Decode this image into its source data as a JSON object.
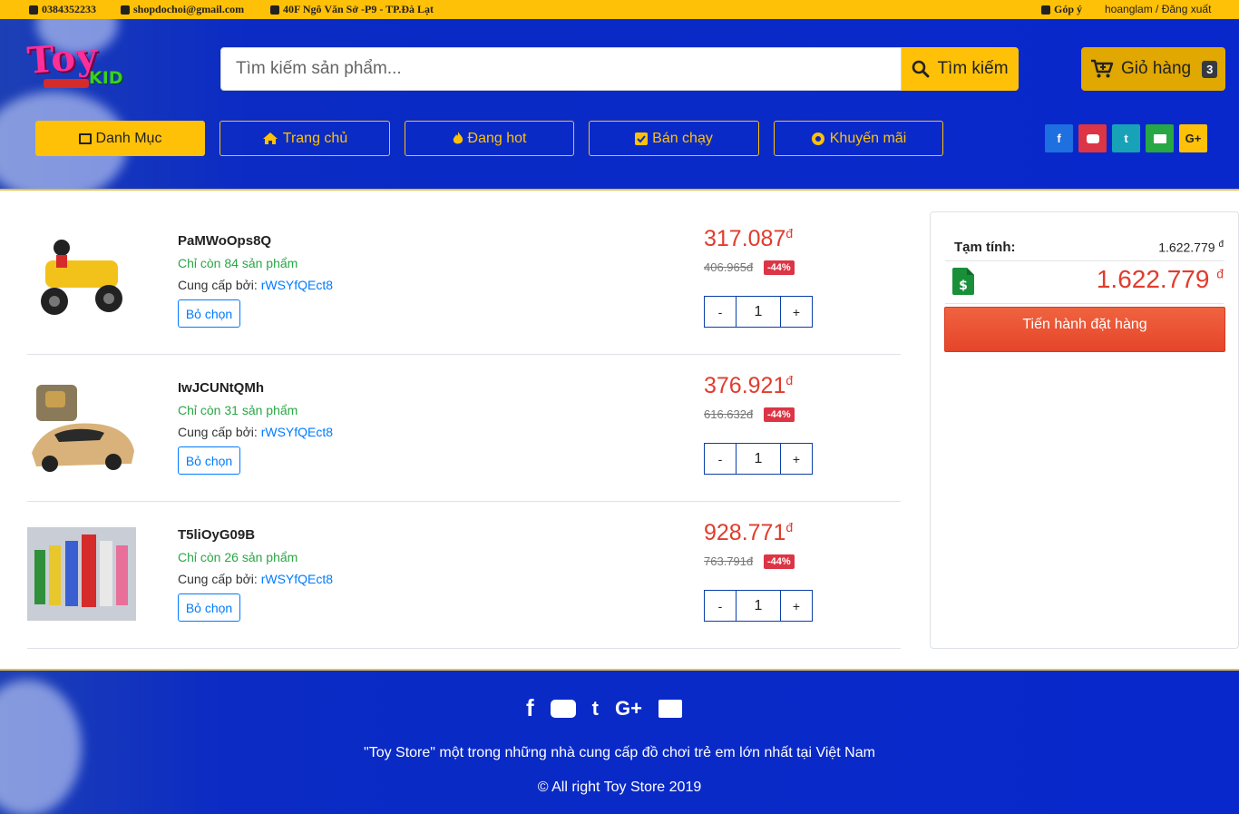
{
  "topbar": {
    "phone": "0384352233",
    "email": "shopdochoi@gmail.com",
    "address": "40F Ngô Văn Sở -P9 - TP.Đà Lạt",
    "feedback": "Góp ý",
    "user": "hoanglam / Đăng xuất"
  },
  "header": {
    "logo_word1": "Toy",
    "logo_word2": "KID",
    "search_placeholder": "Tìm kiếm sản phẩm...",
    "search_button": "Tìm kiếm",
    "cart_label": "Giỏ hàng",
    "cart_count": "3"
  },
  "nav": {
    "category": "Danh Mục",
    "home": "Trang chủ",
    "hot": "Đang hot",
    "bestseller": "Bán chạy",
    "promo": "Khuyến mãi"
  },
  "social": [
    "facebook-icon",
    "youtube-icon",
    "twitter-icon",
    "envelope-icon",
    "google-plus-icon"
  ],
  "cart_items": [
    {
      "name": "PaMWoOps8Q",
      "stock": "Chỉ còn 84 sản phẩm",
      "supplier_label": "Cung cấp bởi:",
      "supplier": "rWSYfQEct8",
      "remove": "Bỏ chọn",
      "price": "317.087",
      "currency": "đ",
      "old_price": "406.965đ",
      "discount": "-44%",
      "qty": "1"
    },
    {
      "name": "IwJCUNtQMh",
      "stock": "Chỉ còn 31 sản phẩm",
      "supplier_label": "Cung cấp bởi:",
      "supplier": "rWSYfQEct8",
      "remove": "Bỏ chọn",
      "price": "376.921",
      "currency": "đ",
      "old_price": "616.632đ",
      "discount": "-44%",
      "qty": "1"
    },
    {
      "name": "T5liOyG09B",
      "stock": "Chỉ còn 26 sản phẩm",
      "supplier_label": "Cung cấp bởi:",
      "supplier": "rWSYfQEct8",
      "remove": "Bỏ chọn",
      "price": "928.771",
      "currency": "đ",
      "old_price": "763.791đ",
      "discount": "-44%",
      "qty": "1"
    }
  ],
  "summary": {
    "subtotal_label": "Tạm tính:",
    "subtotal": "1.622.779",
    "total": "1.622.779",
    "currency": "đ",
    "checkout": "Tiến hành đặt hàng"
  },
  "qty_controls": {
    "minus": "-",
    "plus": "+"
  },
  "footer": {
    "tagline": "\"Toy Store\" một trong những nhà cung cấp đồ chơi trẻ em lớn nhất tại Việt Nam",
    "copyright": "© All right Toy Store 2019"
  },
  "colors": {
    "accent": "#ffc107",
    "header_blue": "#0828cc",
    "price_red": "#e03c2e",
    "stock_green": "#28a745",
    "checkout_red": "#ee5a3a"
  }
}
